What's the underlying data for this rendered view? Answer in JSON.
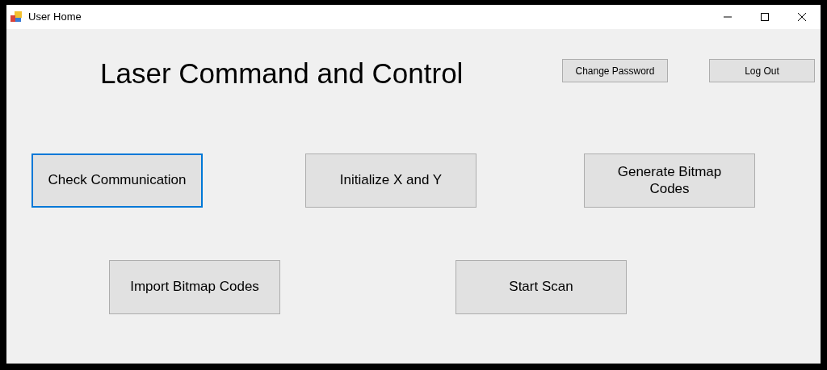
{
  "window": {
    "title": "User Home"
  },
  "heading": "Laser Command and Control",
  "header_buttons": [
    {
      "label": "Change Password"
    },
    {
      "label": "Log Out"
    }
  ],
  "button_rows": [
    [
      {
        "label": "Check Communication",
        "focused": true
      },
      {
        "label": "Initialize X and Y",
        "focused": false
      },
      {
        "label": "Generate Bitmap Codes",
        "focused": false
      }
    ],
    [
      {
        "label": "Import Bitmap Codes",
        "focused": false
      },
      {
        "label": "Start Scan",
        "focused": false
      }
    ]
  ]
}
